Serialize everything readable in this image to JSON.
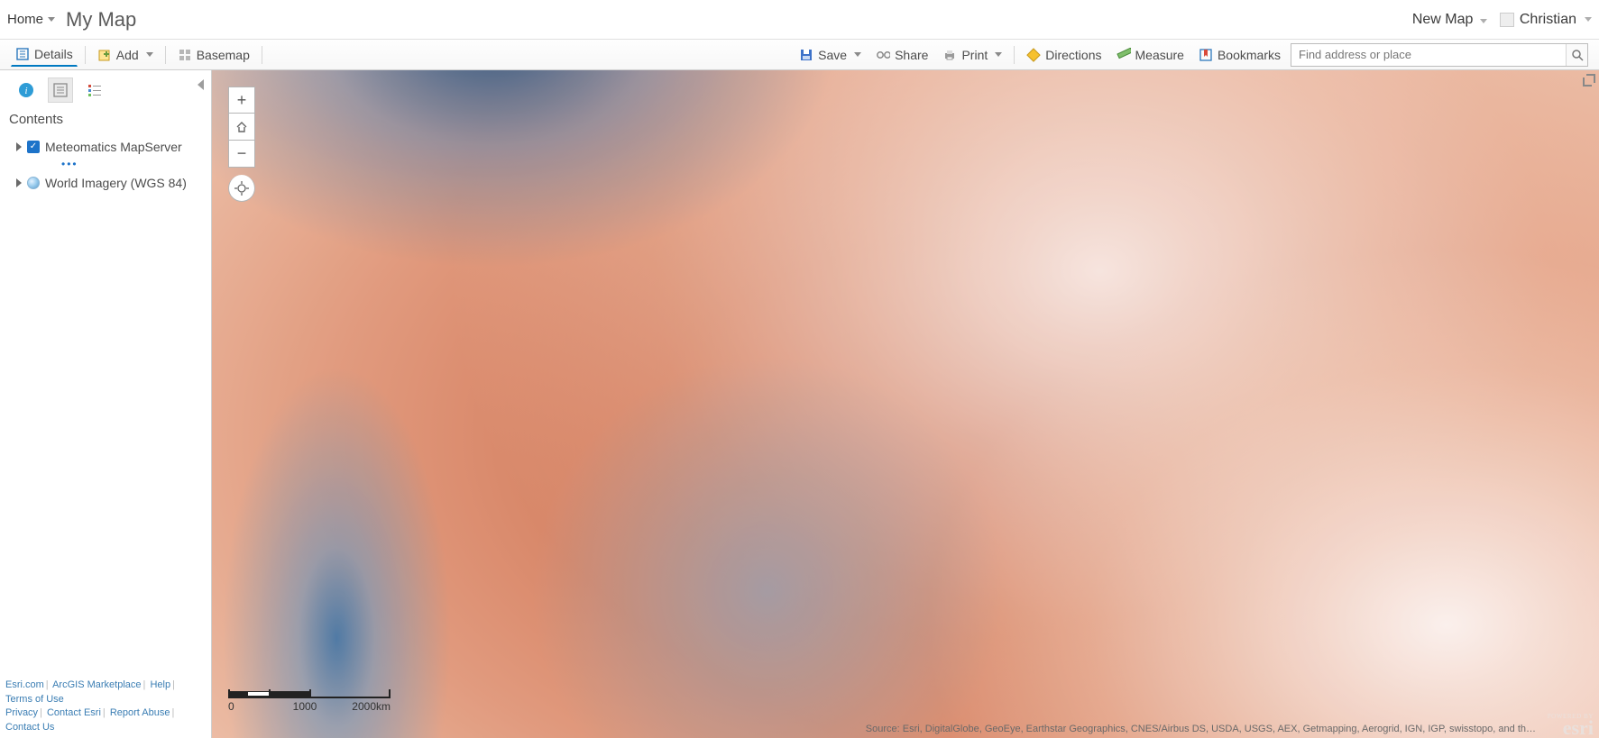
{
  "header": {
    "home": "Home",
    "title": "My Map",
    "new_map": "New Map",
    "user": "Christian"
  },
  "toolbar": {
    "details": "Details",
    "add": "Add",
    "basemap": "Basemap",
    "save": "Save",
    "share": "Share",
    "print": "Print",
    "directions": "Directions",
    "measure": "Measure",
    "bookmarks": "Bookmarks",
    "search_placeholder": "Find address or place"
  },
  "sidebar": {
    "panel_title": "Contents",
    "layers": [
      {
        "name": "Meteomatics MapServer",
        "checked": true,
        "expandable": true,
        "has_more": true
      },
      {
        "name": "World Imagery (WGS 84)",
        "checked": false,
        "expandable": true,
        "has_more": false,
        "icon": "globe"
      }
    ],
    "footer_links_row1": [
      "Esri.com",
      "ArcGIS Marketplace",
      "Help",
      "Terms of Use"
    ],
    "footer_links_row2": [
      "Privacy",
      "Contact Esri",
      "Report Abuse",
      "Contact Us"
    ]
  },
  "map": {
    "scalebar": {
      "l0": "0",
      "l1": "1000",
      "l2": "2000km"
    },
    "attribution": "Source: Esri, DigitalGlobe, GeoEye, Earthstar Geographics, CNES/Airbus DS, USDA, USGS, AEX, Getmapping, Aerogrid, IGN, IGP, swisstopo, and th…",
    "powered_by": "POWERED BY",
    "esri": "esri"
  }
}
